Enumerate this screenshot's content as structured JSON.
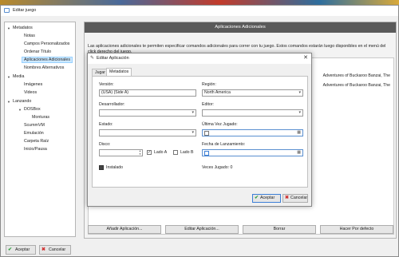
{
  "window": {
    "title": "Editar juego"
  },
  "sidebar": {
    "items": [
      {
        "label": "Metadatos",
        "expanded": true
      },
      {
        "label": "Notas"
      },
      {
        "label": "Campos Personalizados"
      },
      {
        "label": "Ordenar Título"
      },
      {
        "label": "Aplicaciones Adicionales",
        "selected": true
      },
      {
        "label": "Nombres Alternativos"
      },
      {
        "label": "Media",
        "expanded": true
      },
      {
        "label": "Imágenes"
      },
      {
        "label": "Videos"
      },
      {
        "label": "Lanzando",
        "expanded": true
      },
      {
        "label": "DOSBox",
        "expanded": true
      },
      {
        "label": "Monturas"
      },
      {
        "label": "ScummVM"
      },
      {
        "label": "Emulación"
      },
      {
        "label": "Carpeta Raíz"
      },
      {
        "label": "Inicio/Pausa"
      }
    ]
  },
  "panel": {
    "header": "Aplicaciones Adicionales",
    "description": "Las aplicaciones adicionales te permiten especificar comandos adicionales para correr con tu juego. Estos comandos estarán luego disponibles en el menú del click derecho del juego.",
    "rows": [
      "Adventures of Buckaroo Banzai, The",
      "Adventures of Buckaroo Banzai, The"
    ],
    "buttons": {
      "add": "Añadir Aplicación...",
      "edit": "Editar Aplicación...",
      "delete": "Borrar",
      "default": "Hacer Por defecto"
    }
  },
  "footer": {
    "accept": "Aceptar",
    "cancel": "Cancelar"
  },
  "dialog": {
    "title": "Editar Aplicación",
    "tabs": [
      "Jugar",
      "Metadatos"
    ],
    "active_tab": "Metadatos",
    "fields": {
      "version_label": "Versión:",
      "version_value": "(USA) (Side A)",
      "region_label": "Región:",
      "region_value": "North America",
      "developer_label": "Desarrollador:",
      "developer_value": "",
      "editor_label": "Editor:",
      "editor_value": "",
      "status_label": "Estado:",
      "status_value": "",
      "last_played_label": "Última Vez Jugado:",
      "disc_label": "Disco:",
      "side_a_label": "Lado A",
      "side_a_checked": true,
      "side_b_label": "Lado B",
      "side_b_checked": false,
      "release_date_label": "Fecha de Lanzamiento:",
      "installed_label": "Instalado",
      "installed_checked": true,
      "times_played_label": "Veces Jugado: 0"
    },
    "buttons": {
      "accept": "Aceptar",
      "cancel": "Cancelar"
    }
  },
  "icons": {
    "check": "✔",
    "cross": "✖",
    "pencil": "✎",
    "close": "✕",
    "dropdown": "▾",
    "calendar": "▦"
  }
}
